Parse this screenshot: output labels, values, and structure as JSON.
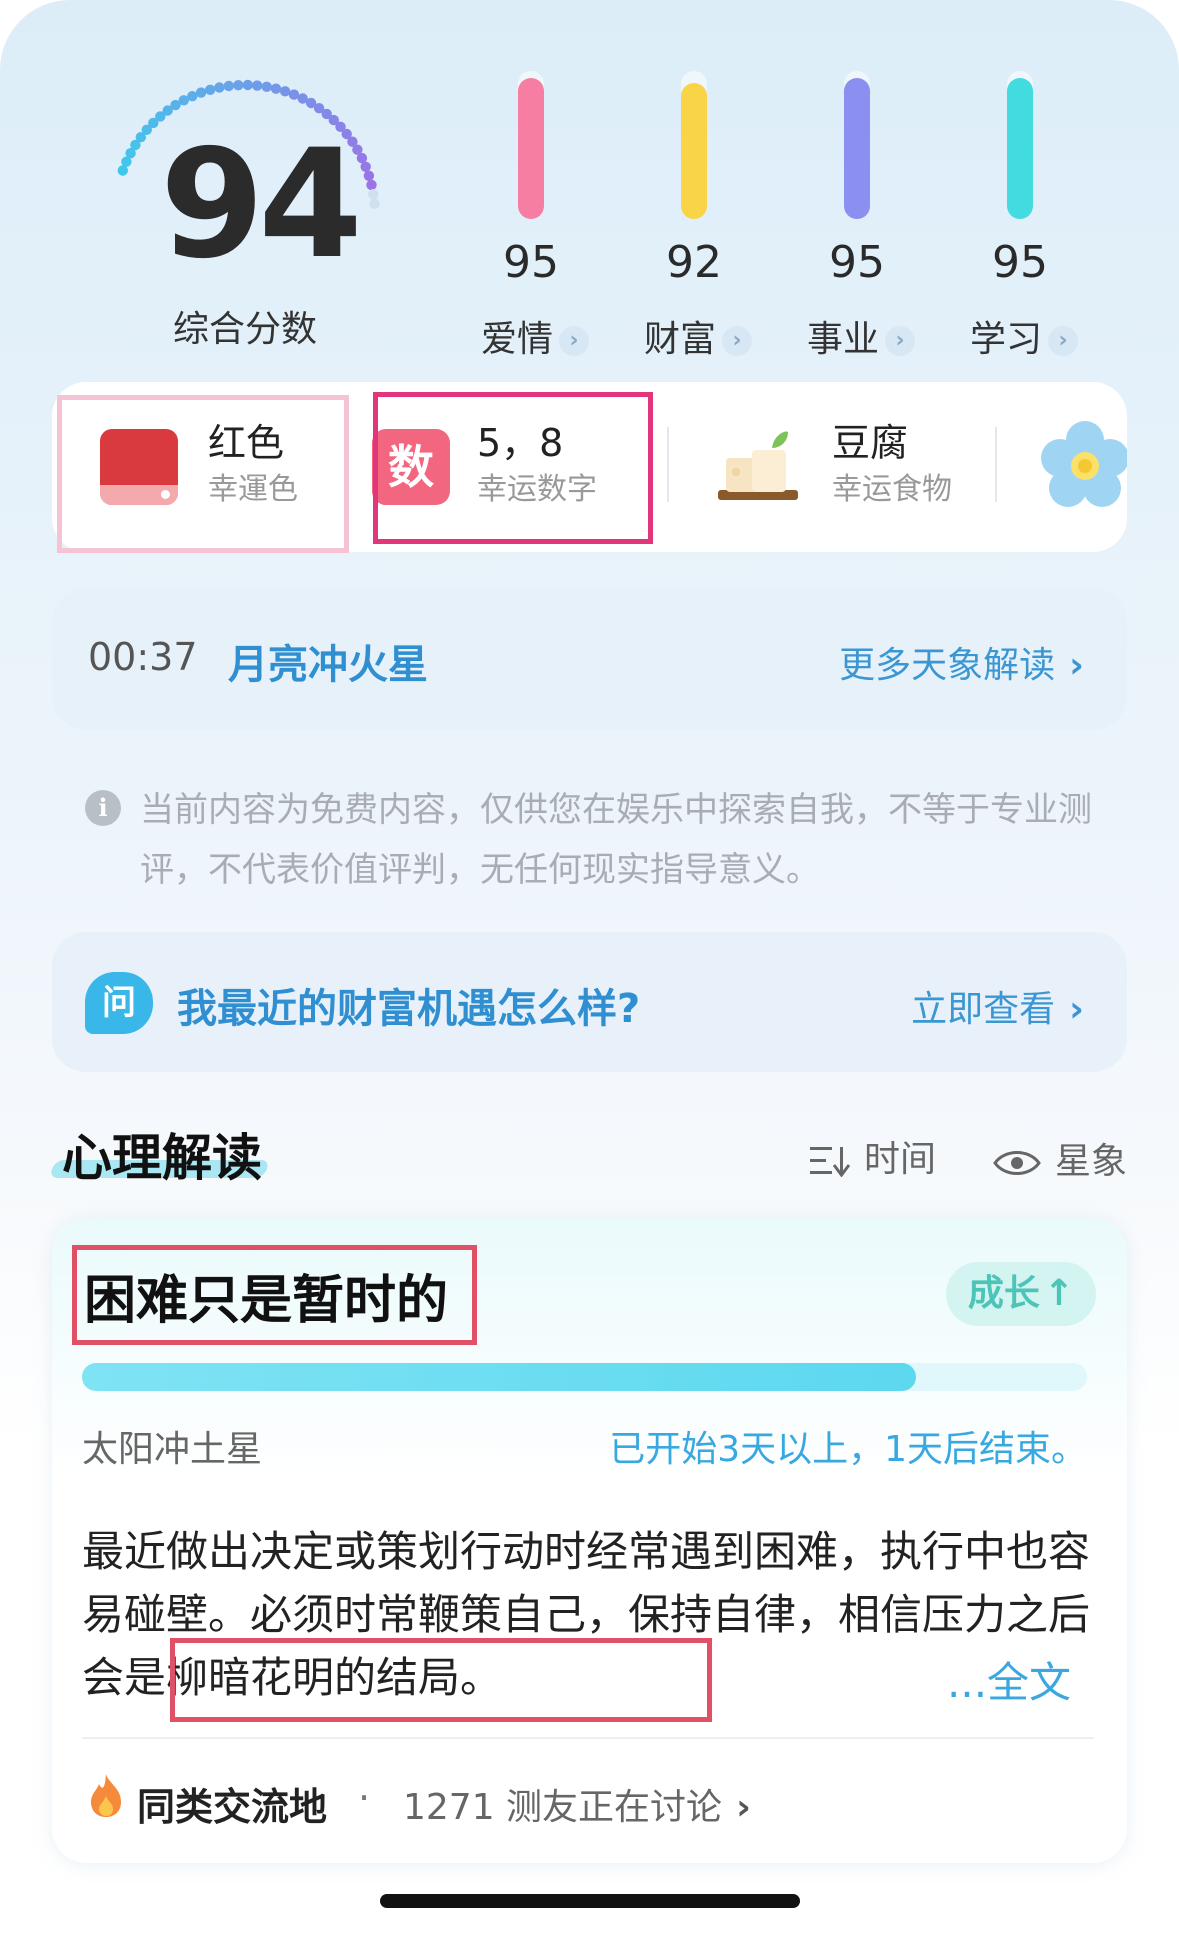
{
  "overall": {
    "score": "94",
    "label": "综合分数",
    "dial_level": 0.94
  },
  "categories": [
    {
      "value": "95",
      "name": "爱情",
      "color": "#f67ea3",
      "level": 0.95
    },
    {
      "value": "92",
      "name": "财富",
      "color": "#f9d447",
      "level": 0.92
    },
    {
      "value": "95",
      "name": "事业",
      "color": "#8a8ff0",
      "level": 0.95
    },
    {
      "value": "95",
      "name": "学习",
      "color": "#42dbe0",
      "level": 0.95
    }
  ],
  "lucky": {
    "color": {
      "title": "红色",
      "sub": "幸運色",
      "swatch": "#d93a3f"
    },
    "number": {
      "badge": "数",
      "title": "5，8",
      "sub": "幸运数字"
    },
    "food": {
      "title": "豆腐",
      "sub": "幸运食物"
    }
  },
  "event": {
    "time": "00:37",
    "name": "月亮冲火星",
    "more": "更多天象解读"
  },
  "notice": {
    "icon": "i",
    "text": "当前内容为免费内容，仅供您在娱乐中探索自我，不等于专业测评，不代表价值评判，无任何现实指导意义。"
  },
  "question": {
    "icon": "问",
    "text": "我最近的财富机遇怎么样?",
    "action": "立即查看"
  },
  "section": {
    "title": "心理解读",
    "sort_label": "时间",
    "view_label": "星象"
  },
  "reading": {
    "headline": "困难只是暂时的",
    "tag": "成长",
    "progress": 0.83,
    "transit": "太阳冲土星",
    "duration": "已开始3天以上，1天后结束。",
    "body_part1": "最近做出决定或策划行动时经常遇到困难，执行中也容易碰壁。必须时常鞭策自己，保持自律，相信压力",
    "body_part2": "之后会是柳暗花明的结局。",
    "fulltext": "...全文"
  },
  "community": {
    "name": "同类交流地",
    "dot": "·",
    "count": "1271 测友正在讨论"
  },
  "colors": {
    "accent_blue": "#2f8fd1",
    "highlight_red": "#e05067",
    "highlight_magenta": "#e2367a"
  }
}
